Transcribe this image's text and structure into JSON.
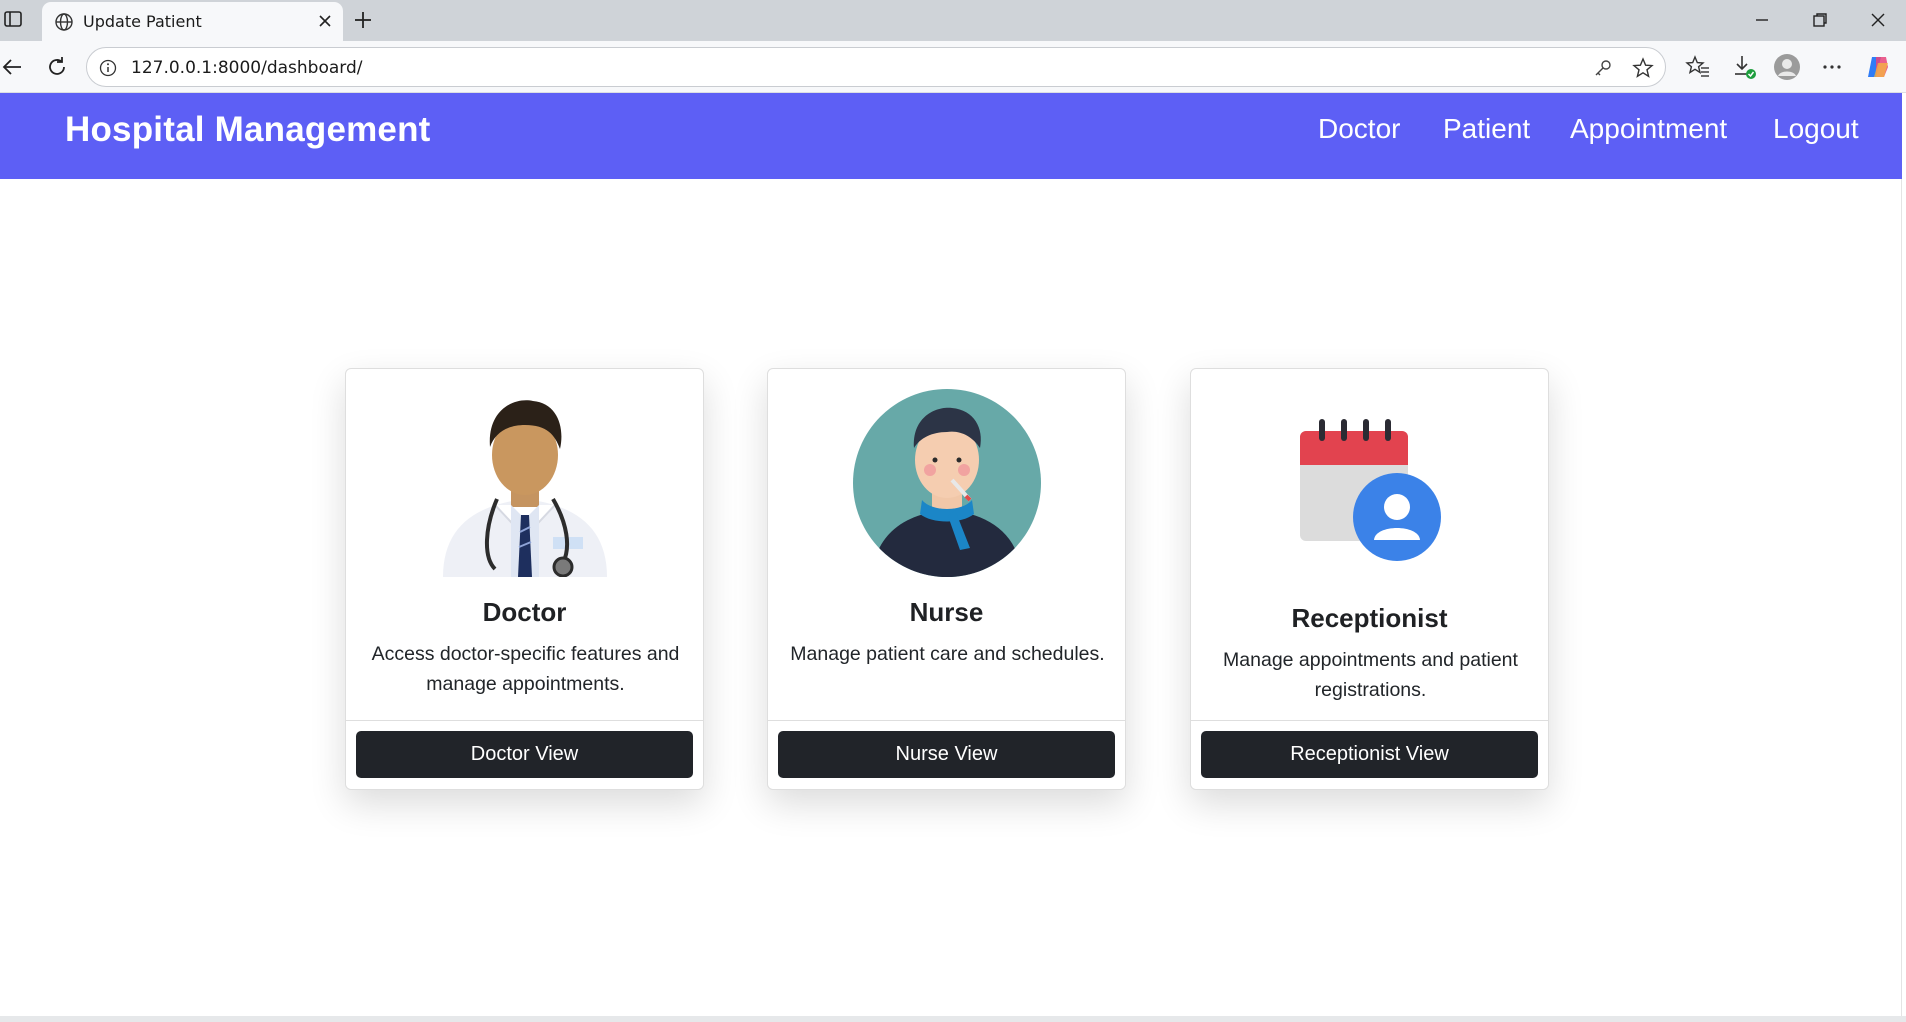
{
  "browser": {
    "tab_title": "Update Patient",
    "url": "127.0.0.1:8000/dashboard/"
  },
  "navbar": {
    "brand": "Hospital Management",
    "links": [
      "Doctor",
      "Patient",
      "Appointment",
      "Logout"
    ],
    "background_color": "#5d5ff5"
  },
  "cards": [
    {
      "title": "Doctor",
      "text": "Access doctor-specific features and manage appointments.",
      "button": "Doctor View",
      "image_icon": "doctor-avatar-icon"
    },
    {
      "title": "Nurse",
      "text": "Manage patient care and schedules.",
      "button": "Nurse View",
      "image_icon": "sick-patient-avatar-icon"
    },
    {
      "title": "Receptionist",
      "text": "Manage appointments and patient registrations.",
      "button": "Receptionist View",
      "image_icon": "calendar-user-icon"
    }
  ]
}
